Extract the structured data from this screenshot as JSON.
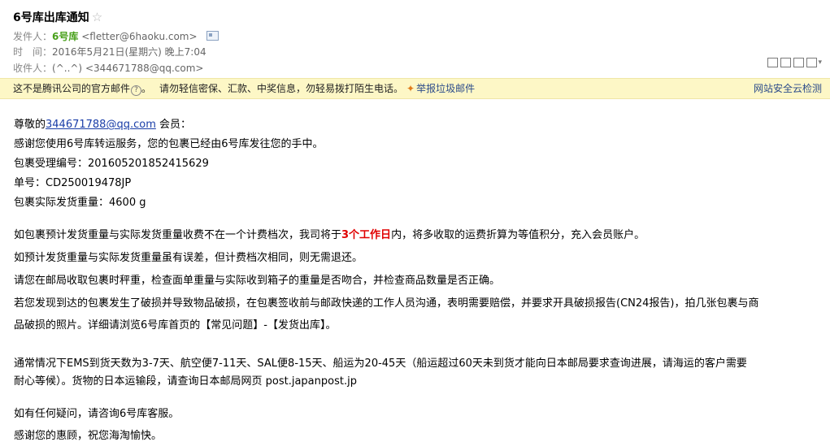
{
  "subject": "6号库出库通知",
  "star_glyph": "☆",
  "sender": {
    "label": "发件人：",
    "name": "6号库",
    "email": "<fletter@6haoku.com>"
  },
  "time": {
    "label": "时　间：",
    "value": "2016年5月21日(星期六) 晚上7:04"
  },
  "recipient": {
    "label": "收件人：",
    "name": "(^..^)",
    "email": "<344671788@qq.com>"
  },
  "warning": {
    "notice": "这不是腾讯公司的官方邮件",
    "q_glyph": "?",
    "notice_end": "。",
    "advice": "请勿轻信密保、汇款、中奖信息，勿轻易拨打陌生电话。",
    "report": "举报垃圾邮件",
    "security": "网站安全云检测"
  },
  "body": {
    "greeting_pre": "尊敬的",
    "greeting_link": "344671788@qq.com",
    "greeting_post": " 会员：",
    "thanks": "感谢您使用6号库转运服务，您的包裹已经由6号库发往您的手中。",
    "pkg_no": "包裹受理编号：201605201852415629",
    "tracking": "单号：CD250019478JP",
    "weight": "包裹实际发货重量：4600 g",
    "p1_pre": "如包裹预计发货重量与实际发货重量收费不在一个计费档次，我司将于",
    "p1_red": "3个工作日",
    "p1_post": "内，将多收取的运费折算为等值积分，充入会员账户。",
    "p2": "如预计发货重量与实际发货重量虽有误差，但计费档次相同，则无需退还。",
    "p3": "请您在邮局收取包裹时秤重，检查面单重量与实际收到箱子的重量是否吻合，并检查商品数量是否正确。",
    "p4a": "若您发现到达的包裹发生了破损并导致物品破损，在包裹签收前与邮政快递的工作人员沟通，表明需要赔偿，并要求开具破损报告(CN24报告)，拍几张包裹与商",
    "p4b": "品破损的照片。详细请浏览6号库首页的【常见问题】-【发货出库】。",
    "p5a": "通常情况下EMS到货天数为3-7天、航空便7-11天、SAL便8-15天、船运为20-45天（船运超过60天未到货才能向日本邮局要求查询进展，请海运的客户需要",
    "p5b": "耐心等候）。货物的日本运输段，请查询日本邮局网页 post.japanpost.jp",
    "p6": "如有任何疑问，请咨询6号库客服。",
    "p7": "感谢您的惠顾，祝您海淘愉快。"
  }
}
